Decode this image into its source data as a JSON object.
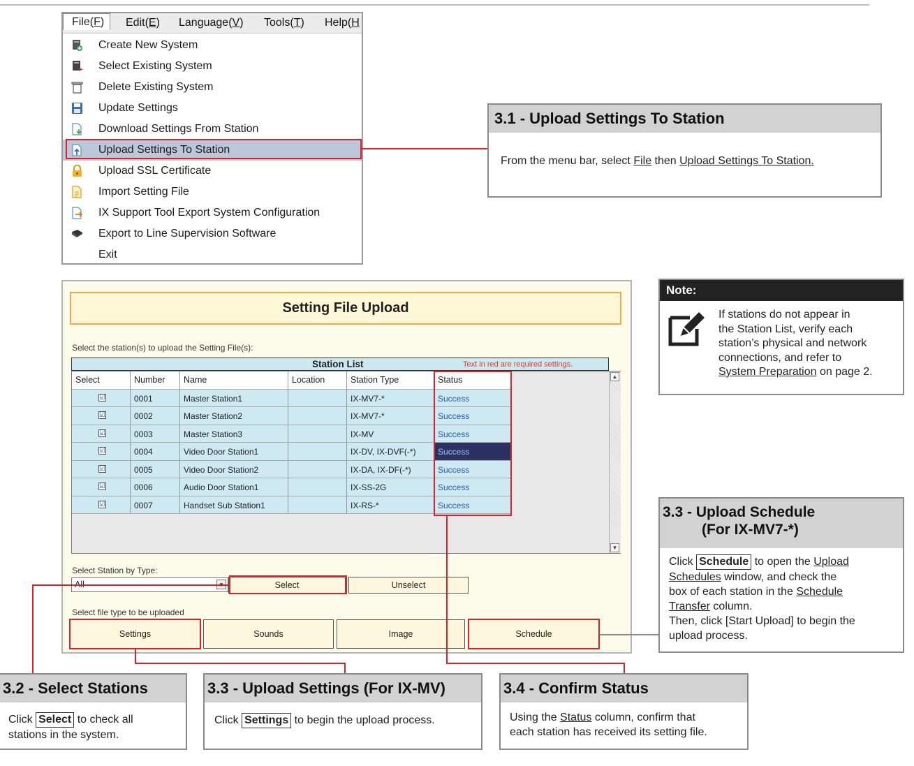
{
  "menu": {
    "bar": [
      {
        "label": "File(",
        "u": "F",
        "end": ")"
      },
      {
        "label": "Edit(",
        "u": "E",
        "end": ")"
      },
      {
        "label": "Language(",
        "u": "V",
        "end": ")"
      },
      {
        "label": "Tools(",
        "u": "T",
        "end": ")"
      },
      {
        "label": "Help(",
        "u": "H",
        "end": ""
      }
    ],
    "items": [
      {
        "label": "Create New System",
        "icon": "create-system-icon"
      },
      {
        "label": "Select Existing System",
        "icon": "select-system-icon"
      },
      {
        "label": "Delete Existing System",
        "icon": "trash-icon"
      },
      {
        "label": "Update Settings",
        "icon": "floppy-disk-icon"
      },
      {
        "label": "Download Settings From Station",
        "icon": "download-icon"
      },
      {
        "label": "Upload Settings To Station",
        "icon": "upload-icon"
      },
      {
        "label": "Upload SSL Certificate",
        "icon": "lock-icon"
      },
      {
        "label": "Import Setting File",
        "icon": "import-file-icon"
      },
      {
        "label": "IX Support Tool Export System Configuration",
        "icon": "export-icon"
      },
      {
        "label": "Export to Line Supervision Software",
        "icon": "line-supervision-icon"
      },
      {
        "label": "Exit",
        "icon": ""
      }
    ]
  },
  "callout31": {
    "title": "3.1 - Upload Settings To Station",
    "t1": "From the menu bar, select ",
    "u1": "File",
    "t2": " then ",
    "u2": "Upload Settings To Station."
  },
  "note": {
    "title": "Note:",
    "l1": "If stations do not appear in",
    "l2": "the Station List, verify each",
    "l3": "station’s physical and network",
    "l4": "connections, and refer to",
    "u": "System Preparation",
    "l5": " on page 2."
  },
  "window": {
    "title": "Setting File Upload",
    "select_prompt": "Select the station(s) to upload the Setting File(s):",
    "station_list": "Station List",
    "required_note": "Text in red are required settings.",
    "columns": [
      "Select",
      "Number",
      "Name",
      "Location",
      "Station Type",
      "Status"
    ],
    "rows": [
      {
        "number": "0001",
        "name": "Master Station1",
        "location": "",
        "type": "IX-MV7-*",
        "status": "Success",
        "checked": "☑"
      },
      {
        "number": "0002",
        "name": "Master Station2",
        "location": "",
        "type": "IX-MV7-*",
        "status": "Success",
        "checked": "☑"
      },
      {
        "number": "0003",
        "name": "Master Station3",
        "location": "",
        "type": "IX-MV",
        "status": "Success",
        "checked": "☑"
      },
      {
        "number": "0004",
        "name": "Video Door Station1",
        "location": "",
        "type": "IX-DV, IX-DVF(-*)",
        "status": "Success",
        "checked": "☑"
      },
      {
        "number": "0005",
        "name": "Video Door Station2",
        "location": "",
        "type": "IX-DA, IX-DF(-*)",
        "status": "Success",
        "checked": "☑"
      },
      {
        "number": "0006",
        "name": "Audio Door Station1",
        "location": "",
        "type": "IX-SS-2G",
        "status": "Success",
        "checked": "☑"
      },
      {
        "number": "0007",
        "name": "Handset Sub Station1",
        "location": "",
        "type": "IX-RS-*",
        "status": "Success",
        "checked": "☑"
      }
    ],
    "select_by_type": "Select Station by Type:",
    "type_value": "All",
    "select_btn": "Select",
    "unselect_btn": "Unselect",
    "file_type_prompt": "Select file type to be uploaded",
    "file_buttons": [
      "Settings",
      "Sounds",
      "Image",
      "Schedule"
    ]
  },
  "callout33s": {
    "title1": "3.3 - Upload Schedule",
    "title2": "(For IX-MV7-*)",
    "t_click": "Click ",
    "k_schedule": "Schedule",
    "t_open": " to open the ",
    "u_upload": "Upload",
    "u_schedules": "Schedules",
    "t_window": " window, and check the",
    "t_box": "box of  each station in the ",
    "u_schedule": "Schedule",
    "u_transfer": "Transfer",
    "t_column": " column.",
    "t_then": "Then, click [Start Upload] to begin the",
    "t_upload": "upload process."
  },
  "callout32": {
    "title": "3.2 - Select Stations",
    "t_click": "Click ",
    "k": "Select",
    "t_rest": " to check all",
    "t_l2": "stations in the system."
  },
  "callout33": {
    "title": "3.3 - Upload Settings (For IX-MV)",
    "t_click": "Click ",
    "k": "Settings",
    "t_rest": " to begin the upload process."
  },
  "callout34": {
    "title": "3.4 - Confirm Status",
    "t1": "Using the ",
    "u": "Status",
    "t2": " column, confirm that",
    "t3": "each station has received its setting file."
  },
  "colors": {
    "accent_red": "#d8232a",
    "status_blue": "#2759b5",
    "row_bg": "#cde9f1",
    "selected_status_bg": "#2a3262"
  }
}
